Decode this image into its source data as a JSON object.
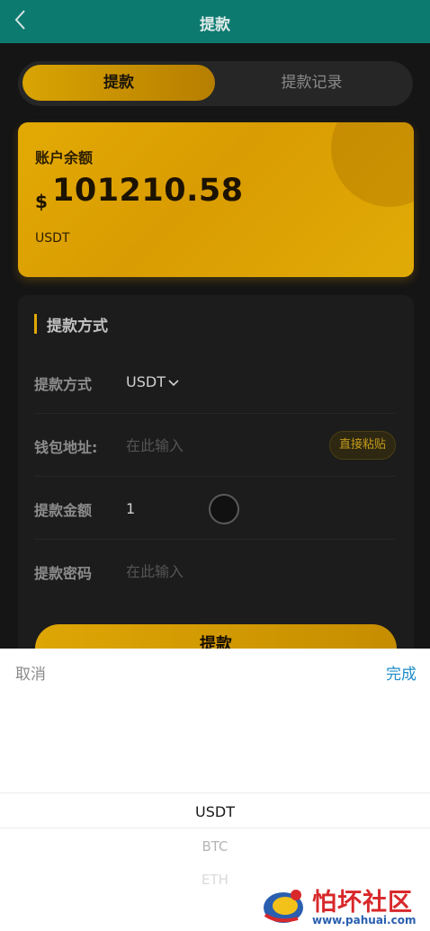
{
  "header": {
    "title": "提款",
    "back_icon": "chevron-left-icon"
  },
  "tabs": [
    {
      "label": "提款",
      "active": true
    },
    {
      "label": "提款记录",
      "active": false
    }
  ],
  "balance": {
    "label": "账户余额",
    "currency_symbol": "$",
    "amount": "101210.58",
    "unit": "USDT"
  },
  "form": {
    "section_title": "提款方式",
    "method": {
      "label": "提款方式",
      "value": "USDT"
    },
    "wallet": {
      "label": "钱包地址:",
      "placeholder": "在此输入",
      "paste_label": "直接粘贴"
    },
    "amount": {
      "label": "提款金额",
      "value": "1"
    },
    "password": {
      "label": "提款密码",
      "placeholder": "在此输入"
    },
    "submit_label": "提款"
  },
  "picker": {
    "cancel_label": "取消",
    "done_label": "完成",
    "options": [
      "USDT",
      "BTC",
      "ETH"
    ],
    "selected": "USDT"
  },
  "watermark": {
    "text": "怕坏社区",
    "url": "www.pahuai.com"
  },
  "colors": {
    "header": "#0d7a70",
    "accent": "#e1a804",
    "done": "#1f8cc9"
  }
}
